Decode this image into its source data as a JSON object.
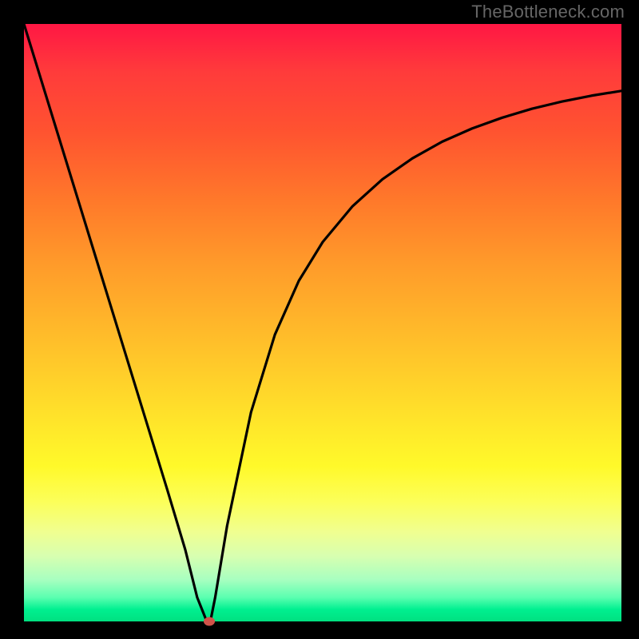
{
  "watermark": "TheBottleneck.com",
  "colors": {
    "background": "#000000",
    "curve": "#000000",
    "marker": "#d1534a"
  },
  "chart_data": {
    "type": "line",
    "title": "",
    "xlabel": "",
    "ylabel": "",
    "xlim": [
      0,
      100
    ],
    "ylim": [
      0,
      100
    ],
    "grid": false,
    "legend": false,
    "x": [
      0,
      4,
      8,
      12,
      16,
      20,
      24,
      27,
      29,
      30.6,
      31.2,
      32,
      34,
      38,
      42,
      46,
      50,
      55,
      60,
      65,
      70,
      75,
      80,
      85,
      90,
      95,
      100
    ],
    "values": [
      100,
      87,
      74,
      61,
      48,
      35,
      22,
      12,
      4,
      0,
      0,
      4,
      16,
      35,
      48,
      57,
      63.5,
      69.5,
      74,
      77.5,
      80.3,
      82.5,
      84.3,
      85.8,
      87,
      88,
      88.8
    ],
    "marker": {
      "x": 31,
      "y": 0
    },
    "background_gradient": [
      {
        "stop": 0.0,
        "color": "#ff1744"
      },
      {
        "stop": 0.5,
        "color": "#ffd22a"
      },
      {
        "stop": 0.8,
        "color": "#fcff5a"
      },
      {
        "stop": 1.0,
        "color": "#00e080"
      }
    ]
  }
}
